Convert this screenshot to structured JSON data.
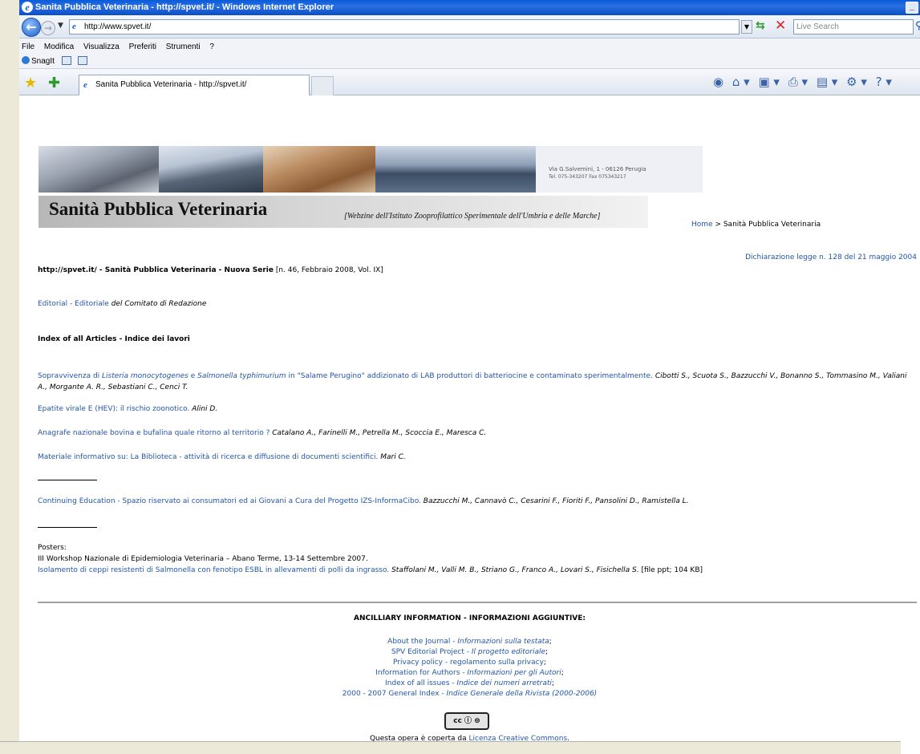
{
  "window": {
    "title": "Sanita Pubblica Veterinaria - http://spvet.it/ - Windows Internet Explorer"
  },
  "address": {
    "url": "http://www.spvet.it/",
    "search_placeholder": "Live Search"
  },
  "menu": {
    "items": [
      "File",
      "Modifica",
      "Visualizza",
      "Preferiti",
      "Strumenti",
      "?"
    ],
    "snagit": "SnagIt"
  },
  "tab": {
    "title": "Sanita Pubblica Veterinaria - http://spvet.it/"
  },
  "header": {
    "address_line1": "Via G.Salvemini, 1 - 06126 Perugia",
    "address_line2": "Tel. 075-343207 Fax 075343217",
    "title": "Sanità Pubblica Veterinaria",
    "subtitle": "[Webzine dell'Istituto Zooprofilattico Sperimentale dell'Umbria e delle Marche]",
    "crumb_home": "Home",
    "crumb_rest": " > Sanità Pubblica Veterinaria"
  },
  "declaration": "Dichiarazione legge n. 128 del 21 maggio 2004",
  "issue": {
    "bold": "http://spvet.it/ - Sanità Pubblica Veterinaria - Nuova Serie",
    "rest": " [n. 46, Febbraio 2008, Vol. IX]"
  },
  "editorial": {
    "link": "Editorial",
    "sep": " - ",
    "link2": "Editoriale",
    "rest": " del Comitato di Redazione"
  },
  "index_heading": "Index of all Articles - Indice dei lavori",
  "articles": [
    {
      "p1": "Sopravvivenza di ",
      "i1": "Listeria monocytogenes",
      "p2": " e ",
      "i2": "Salmonella typhimurium",
      "p3": " in \"Salame Perugino\" addizionato di LAB produttori di batteriocine e contaminato sperimentalmente.",
      "authors": " Cibotti S., Scuota S., Bazzucchi V., Bonanno S., Tommasino M., Valiani A., Morgante A. R., Sebastiani C., Cenci T."
    },
    {
      "title": "Epatite virale E (HEV): il rischio zoonotico.",
      "authors": " Alini D."
    },
    {
      "title": "Anagrafe nazionale bovina e bufalina quale ritorno al territorio ?",
      "authors": " Catalano A., Farinelli M., Petrella M., Scoccia E., Maresca C."
    },
    {
      "title": "Materiale informativo su: La Biblioteca - attività di ricerca e diffusione di documenti scientifici.",
      "authors": " Mari C."
    }
  ],
  "continuing": {
    "title": "Continuing Education - Spazio riservato ai consumatori ed ai Giovani a Cura del Progetto IZS-InformaCibo.",
    "authors": " Bazzucchi M., Cannavò C., Cesarini F., Fioriti F., Pansolini D., Ramistella L."
  },
  "posters": {
    "label": "Posters:",
    "workshop": "III Workshop Nazionale di Epidemiologia Veterinaria – Abano Terme, 13-14 Settembre 2007.",
    "title": "Isolamento di ceppi resistenti di Salmonella con fenotipo ESBL in allevamenti di polli da ingrasso.",
    "authors": " Staffolani M., Valli M. B., Striano G., Franco A., Lovari S., Fisichella S.",
    "file": " [file ppt; 104 KB]"
  },
  "ancillary": {
    "heading": "ANCILLIARY INFORMATION - INFORMAZIONI AGGIUNTIVE:",
    "links": [
      {
        "a": "About the Journal - ",
        "b": "Informazioni sulla testata",
        "c": ";"
      },
      {
        "a": "SPV Editorial Project - ",
        "b": "Il progetto editoriale",
        "c": ";"
      },
      {
        "a": "Privacy policy - regolamento sulla privacy",
        "b": "",
        "c": ";"
      },
      {
        "a": "Information for Authors - ",
        "b": "Informazioni per gli Autori",
        "c": ";"
      },
      {
        "a": "Index of all issues - ",
        "b": "Indice dei numeri arretrati",
        "c": ";"
      },
      {
        "a": "2000 - 2007 General Index - ",
        "b": "Indice Generale della Rivista (2000-2006)",
        "c": ""
      }
    ]
  },
  "license": {
    "badge": "cc ⓘ ⊜",
    "pre": "Questa opera è coperta da ",
    "link": "Licenza Creative Commons",
    "post": "."
  }
}
